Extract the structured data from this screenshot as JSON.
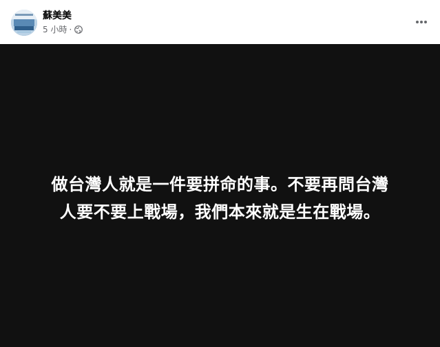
{
  "post": {
    "author_name": "蘇美美",
    "time_label": "5 小時",
    "separator": "·",
    "audience_icon": "globe-icon",
    "more_icon": "more-horizontal-icon",
    "text_line_1": "做台灣人就是一件要拼命的事。不要再問台灣",
    "text_line_2": "人要不要上戰場，我們本來就是生在戰場。",
    "background_color": "#111111",
    "text_color": "#ffffff"
  }
}
